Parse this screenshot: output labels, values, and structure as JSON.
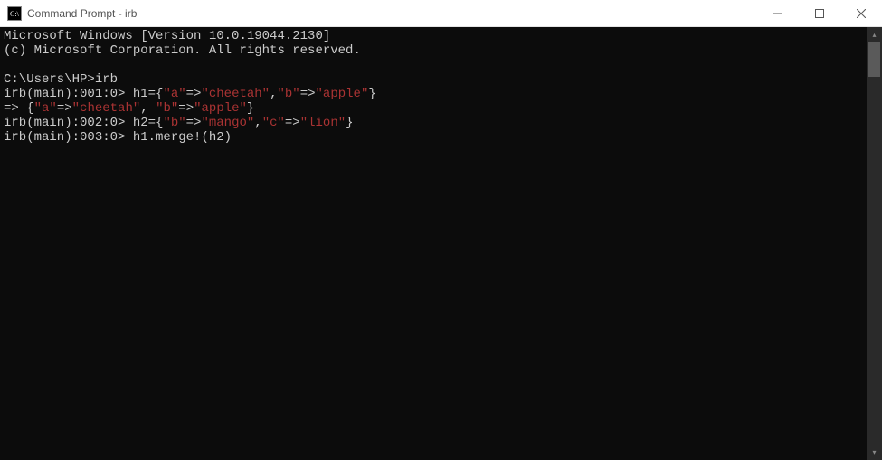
{
  "window": {
    "title": "Command Prompt - irb"
  },
  "terminal": {
    "banner": {
      "l1": "Microsoft Windows [Version 10.0.19044.2130]",
      "l2": "(c) Microsoft Corporation. All rights reserved."
    },
    "cwd_line": "C:\\Users\\HP>irb",
    "lines": {
      "p1": {
        "prompt": "irb(main):001:0> ",
        "s0": "h1={",
        "s1": "\"a\"",
        "s2": "=>",
        "s3": "\"cheetah\"",
        "s4": ",",
        "s5": "\"b\"",
        "s6": "=>",
        "s7": "\"apple\"",
        "s8": "}"
      },
      "r1": {
        "s0": "=> {",
        "s1": "\"a\"",
        "s2": "=>",
        "s3": "\"cheetah\"",
        "s4": ", ",
        "s5": "\"b\"",
        "s6": "=>",
        "s7": "\"apple\"",
        "s8": "}"
      },
      "p2": {
        "prompt": "irb(main):002:0> ",
        "s0": "h2={",
        "s1": "\"b\"",
        "s2": "=>",
        "s3": "\"mango\"",
        "s4": ",",
        "s5": "\"c\"",
        "s6": "=>",
        "s7": "\"lion\"",
        "s8": "}"
      },
      "p3": {
        "prompt": "irb(main):003:0> ",
        "s0": "h1.merge!(h2)"
      }
    }
  }
}
